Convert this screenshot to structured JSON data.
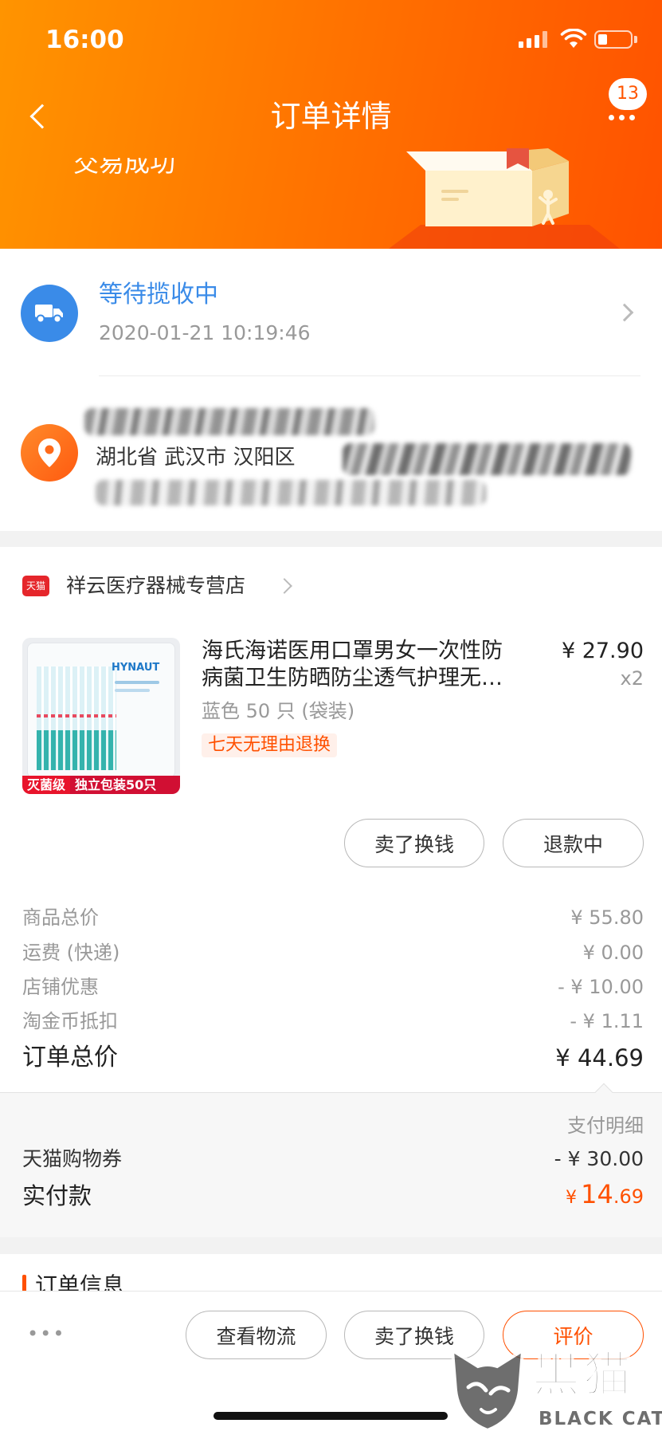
{
  "status_bar": {
    "time": "16:00"
  },
  "nav": {
    "title": "订单详情",
    "message_count": "13"
  },
  "order_status": {
    "text": "交易成功"
  },
  "logistics": {
    "status": "等待揽收中",
    "timestamp": "2020-01-21 10:19:46"
  },
  "address": {
    "region": "湖北省 武汉市 汉阳区"
  },
  "store": {
    "platform_badge": "天猫",
    "name": "祥云医疗器械专营店"
  },
  "product": {
    "title_lines": [
      "海氏海诺医用口罩男女一次性防",
      "病菌卫生防晒防尘透气护理无…"
    ],
    "price": "¥ 27.90",
    "quantity": "x2",
    "sku": "蓝色 50 只 (袋装)",
    "service_tag": "七天无理由退换",
    "image": {
      "brand": "HYNAUT",
      "banner_left": "灭菌级",
      "banner_right": "独立包装50只"
    }
  },
  "item_actions": [
    "卖了换钱",
    "退款中"
  ],
  "price_breakdown": [
    {
      "label": "商品总价",
      "value": "¥ 55.80"
    },
    {
      "label": "运费 (快递)",
      "value": "¥ 0.00"
    },
    {
      "label": "店铺优惠",
      "value": "- ¥ 10.00"
    },
    {
      "label": "淘金币抵扣",
      "value": "- ¥ 1.11"
    }
  ],
  "order_total": {
    "label": "订单总价",
    "value": "¥ 44.69"
  },
  "payment": {
    "detail_link": "支付明细",
    "coupon": {
      "label": "天猫购物券",
      "value": "- ¥ 30.00"
    },
    "paid": {
      "label": "实付款",
      "currency": "¥",
      "integer": "14",
      "decimal": ".69"
    }
  },
  "order_info": {
    "title": "订单信息"
  },
  "bottom_bar": {
    "more": "•••",
    "actions": [
      "查看物流",
      "卖了换钱",
      "评价"
    ]
  },
  "watermark": {
    "cn": "黑猫",
    "en": "BLACK CAT"
  },
  "colors": {
    "header_start": "#ff9400",
    "header_end": "#ff5200",
    "accent": "#ff5000",
    "link_blue": "#3a8be8",
    "tmall_red": "#e5262b"
  },
  "icons": {
    "back": "chevron-left-icon",
    "more": "more-icon",
    "truck": "truck-icon",
    "location": "location-pin-icon",
    "row_arrow": "chevron-right-icon"
  }
}
